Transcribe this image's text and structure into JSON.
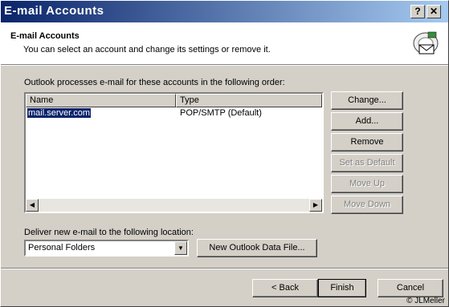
{
  "window": {
    "title": "E-mail Accounts",
    "help_button": "?",
    "close_button": "X"
  },
  "header": {
    "title": "E-mail Accounts",
    "subtitle": "You can select an account and change its settings or remove it.",
    "icon": "mail-accounts-icon"
  },
  "main": {
    "order_label": "Outlook processes e-mail for these accounts in the following order:",
    "columns": [
      "Name",
      "Type"
    ],
    "accounts": [
      {
        "name": "mail.server.com",
        "type": "POP/SMTP (Default)",
        "selected": true
      }
    ],
    "buttons": {
      "change": "Change...",
      "add": "Add...",
      "remove": "Remove",
      "set_default": "Set as Default",
      "move_up": "Move Up",
      "move_down": "Move Down"
    },
    "deliver_label": "Deliver new e-mail to the following location:",
    "deliver_location": "Personal Folders",
    "new_data_file": "New Outlook Data File..."
  },
  "footer": {
    "back": "< Back",
    "finish": "Finish",
    "cancel": "Cancel",
    "credit": "© JLMeller"
  }
}
